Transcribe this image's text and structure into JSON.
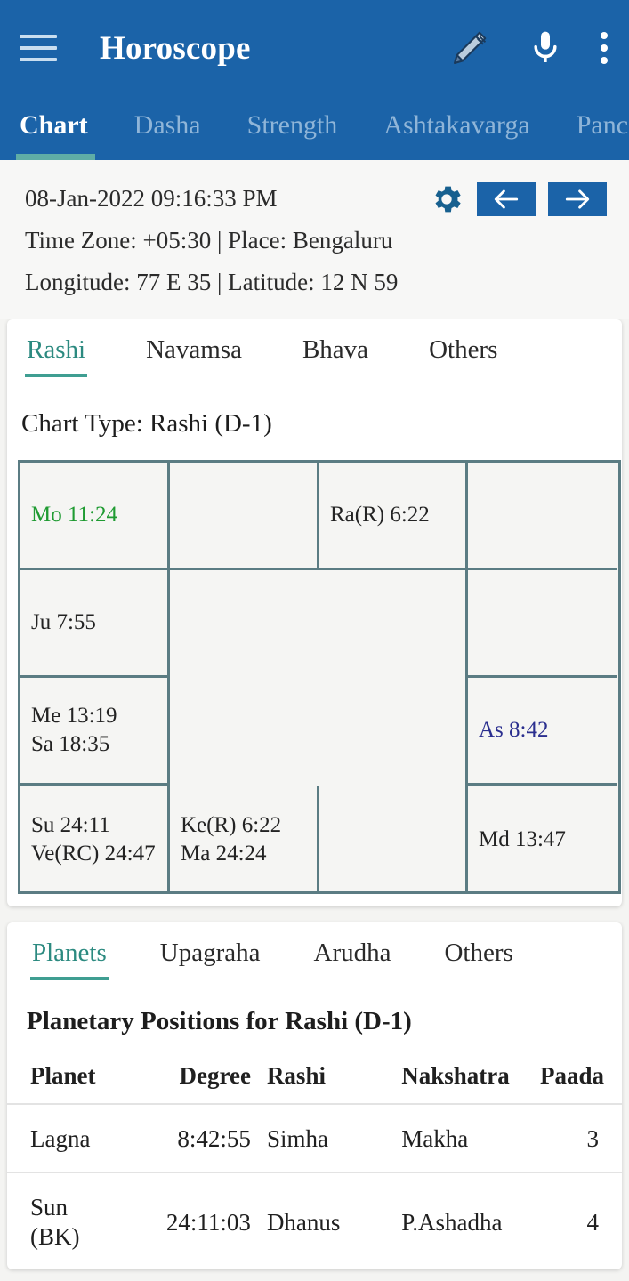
{
  "appbar": {
    "title": "Horoscope",
    "menu_icon": "hamburger-menu-icon",
    "edit_icon": "pencil-icon",
    "voice_icon": "microphone-icon",
    "overflow_icon": "more-vertical-icon"
  },
  "top_tabs": [
    {
      "label": "Chart",
      "active": true
    },
    {
      "label": "Dasha",
      "active": false
    },
    {
      "label": "Strength",
      "active": false
    },
    {
      "label": "Ashtakavarga",
      "active": false
    },
    {
      "label": "Panc",
      "active": false
    }
  ],
  "info": {
    "datetime": "08-Jan-2022 09:16:33 PM",
    "timezone_place": "Time Zone: +05:30 | Place: Bengaluru",
    "coordinates": "Longitude: 77 E 35 | Latitude: 12 N 59",
    "settings_icon": "gear-icon",
    "prev_icon": "arrow-left-icon",
    "next_icon": "arrow-right-icon"
  },
  "chart_card": {
    "tabs": [
      {
        "label": "Rashi",
        "active": true
      },
      {
        "label": "Navamsa",
        "active": false
      },
      {
        "label": "Bhava",
        "active": false
      },
      {
        "label": "Others",
        "active": false
      }
    ],
    "chart_type": "Chart Type: Rashi (D-1)",
    "cells": [
      {
        "lines": [
          {
            "text": "Mo 11:24",
            "color": "moon"
          }
        ]
      },
      {
        "lines": []
      },
      {
        "lines": [
          {
            "text": "Ra(R) 6:22",
            "color": "normal"
          }
        ]
      },
      {
        "lines": []
      },
      {
        "lines": [
          {
            "text": "Ju 7:55",
            "color": "normal"
          }
        ]
      },
      {
        "lines": []
      },
      {
        "lines": [
          {
            "text": "Me 13:19",
            "color": "normal"
          },
          {
            "text": "Sa 18:35",
            "color": "normal"
          }
        ]
      },
      {
        "lines": [
          {
            "text": "As 8:42",
            "color": "asc"
          }
        ]
      },
      {
        "lines": [
          {
            "text": "Su 24:11",
            "color": "normal"
          },
          {
            "text": "Ve(RC) 24:47",
            "color": "normal"
          }
        ]
      },
      {
        "lines": [
          {
            "text": "Ke(R) 6:22",
            "color": "normal"
          },
          {
            "text": "Ma 24:24",
            "color": "normal"
          }
        ]
      },
      {
        "lines": []
      },
      {
        "lines": [
          {
            "text": "Md 13:47",
            "color": "normal"
          }
        ]
      }
    ]
  },
  "planet_card": {
    "tabs": [
      {
        "label": "Planets",
        "active": true
      },
      {
        "label": "Upagraha",
        "active": false
      },
      {
        "label": "Arudha",
        "active": false
      },
      {
        "label": "Others",
        "active": false
      }
    ],
    "title": "Planetary Positions for Rashi (D-1)",
    "columns": [
      "Planet",
      "Degree",
      "Rashi",
      "Nakshatra",
      "Paada"
    ],
    "rows": [
      {
        "planet": "Lagna",
        "degree": "8:42:55",
        "rashi": "Simha",
        "nakshatra": "Makha",
        "paada": "3"
      },
      {
        "planet": "Sun\n(BK)",
        "degree": "24:11:03",
        "rashi": "Dhanus",
        "nakshatra": "P.Ashadha",
        "paada": "4"
      }
    ]
  },
  "colors": {
    "header_blue": "#1b63a8",
    "teal_accent": "#3f9e92",
    "moon_green": "#1f9b32",
    "ascendant_navy": "#2b2f8f",
    "grid_border": "#5b7c83"
  }
}
